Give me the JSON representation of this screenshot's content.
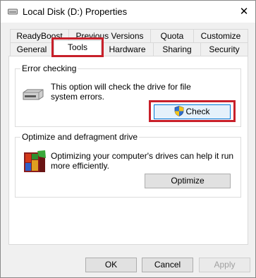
{
  "window": {
    "title": "Local Disk (D:) Properties",
    "close_glyph": "✕",
    "title_icon": "drive-icon",
    "close_icon": "close-icon"
  },
  "tabs": {
    "row_back": [
      "ReadyBoost",
      "Previous Versions",
      "Quota",
      "Customize"
    ],
    "row_front": [
      "General",
      "Tools",
      "Hardware",
      "Sharing",
      "Security"
    ],
    "selected": "Tools"
  },
  "error_checking": {
    "title": "Error checking",
    "desc_line1": "This option will check the drive for file",
    "desc_line2": "system errors.",
    "button_label": "Check",
    "icon": "drive-icon",
    "button_icon": "uac-shield-icon"
  },
  "optimize": {
    "title": "Optimize and defragment drive",
    "desc_line1": "Optimizing your computer's drives can help it run",
    "desc_line2": "more efficiently.",
    "button_label": "Optimize",
    "icon": "defrag-icon"
  },
  "footer": {
    "ok_label": "OK",
    "cancel_label": "Cancel",
    "apply_label": "Apply"
  },
  "colors": {
    "highlight": "#c8202a",
    "focus": "#0078d7"
  }
}
